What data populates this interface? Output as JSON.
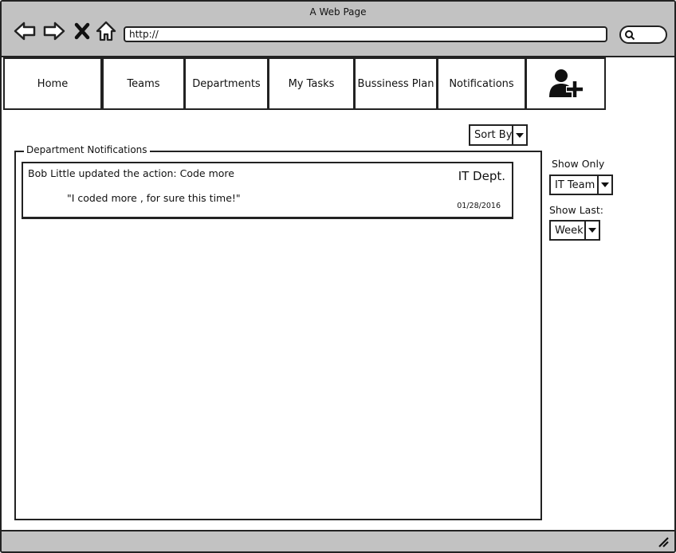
{
  "window": {
    "title": "A Web Page"
  },
  "browser": {
    "url": "http://"
  },
  "tabs": [
    {
      "label": "Home"
    },
    {
      "label": "Teams"
    },
    {
      "label": "Departments"
    },
    {
      "label": "My Tasks"
    },
    {
      "label": "Bussiness Plan"
    },
    {
      "label": "Notifications"
    }
  ],
  "add_user_icon": "add-user-icon",
  "sort": {
    "label": "Sort By"
  },
  "panel": {
    "title": "Department Notifications"
  },
  "notifications": [
    {
      "text": "Bob Little updated the action: Code more",
      "quote": "\"I coded more , for sure this time!\"",
      "department": "IT Dept.",
      "date": "01/28/2016"
    }
  ],
  "filters": {
    "show_only": {
      "label": "Show Only",
      "value": "IT Team"
    },
    "show_last": {
      "label": "Show Last:",
      "value": "Week"
    }
  }
}
